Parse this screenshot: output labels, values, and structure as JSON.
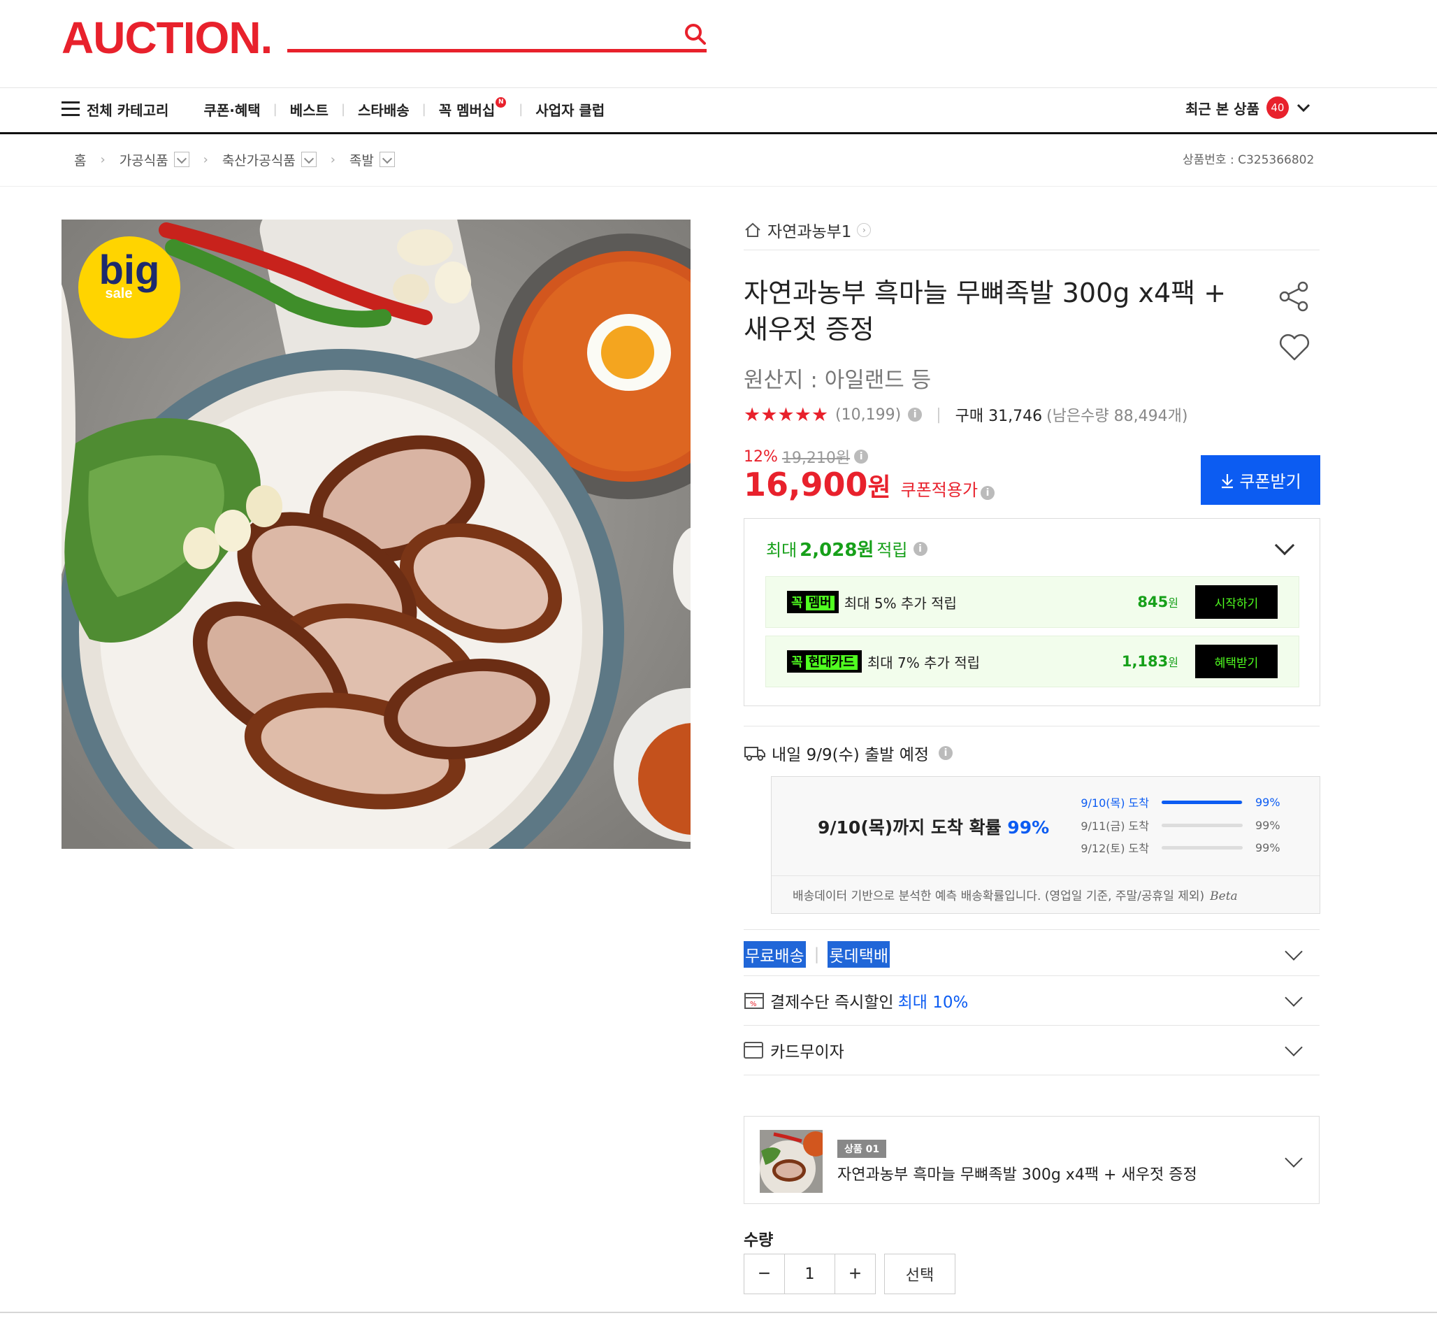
{
  "header": {
    "logo": "AUCTION.",
    "colors": {
      "brand": "#e8212c",
      "blue": "#0c5cf2",
      "green": "#17a01a",
      "neon": "#50ff20"
    },
    "nav": [
      {
        "label": "전체 카테고리",
        "icon": "hamburger-icon"
      },
      {
        "label": "쿠폰·혜택"
      },
      {
        "label": "베스트"
      },
      {
        "label": "스타배송"
      },
      {
        "label": "꼭 멤버십",
        "badge": "N"
      },
      {
        "label": "사업자 클럽"
      }
    ],
    "recent_label": "최근 본 상품",
    "recent_count": "40"
  },
  "breadcrumb": {
    "home": "홈",
    "items": [
      "가공식품",
      "축산가공식품",
      "족발"
    ],
    "product_no": "상품번호 : C325366802"
  },
  "image": {
    "badge_big": "big",
    "badge_sale": "sale"
  },
  "product": {
    "seller": "자연과농부1",
    "title": "자연과농부 흑마늘 무뼈족발 300g x4팩 + 새우젓 증정",
    "origin": "원산지 : 아일랜드 등",
    "rating": 4.5,
    "stars": "★★★★★",
    "review_count": "(10,199)",
    "purchase": "구매 31,746",
    "remaining": "(남은수량 88,494개)",
    "discount_pct": "12%",
    "original_price": "19,210원",
    "price": "16,900",
    "price_unit": "원",
    "price_label": "쿠폰적용가",
    "coupon_button": "쿠폰받기"
  },
  "rewards": {
    "prefix": "최대",
    "amount": "2,028원",
    "suffix": "적립",
    "rows": [
      {
        "tag": "꼭",
        "tag_hi": "멤버",
        "desc": "최대 5% 추가 적립",
        "amount": "845",
        "unit": "원",
        "button": "시작하기"
      },
      {
        "tag": "꼭",
        "tag_hi": "현대카드",
        "desc": "최대 7% 추가 적립",
        "amount": "1,183",
        "unit": "원",
        "button": "혜택받기"
      }
    ]
  },
  "shipping": {
    "departure": "내일 9/9(수) 출발 예정",
    "prob_main": "9/10(목)까지 도착 확률",
    "prob_main_pct": "99%",
    "rows": [
      {
        "label": "9/10(목) 도착",
        "pct": "99%",
        "value": 99,
        "active": true
      },
      {
        "label": "9/11(금) 도착",
        "pct": "99%",
        "value": 0,
        "active": false
      },
      {
        "label": "9/12(토) 도착",
        "pct": "99%",
        "value": 0,
        "active": false
      }
    ],
    "note": "배송데이터 기반으로 분석한 예측 배송확률입니다. (영업일 기준, 주말/공휴일 제외)",
    "beta": "Beta"
  },
  "options": {
    "free_shipping": "무료배송",
    "carrier": "롯데택배",
    "payment_discount": "결제수단 즉시할인",
    "payment_discount_max": "최대 10%",
    "installment": "카드무이자"
  },
  "selection": {
    "badge": "상품 01",
    "name": "자연과농부 흑마늘 무뼈족발 300g x4팩 + 새우젓 증정"
  },
  "quantity": {
    "label": "수량",
    "value": "1",
    "minus": "−",
    "plus": "+",
    "select_button": "선택"
  }
}
